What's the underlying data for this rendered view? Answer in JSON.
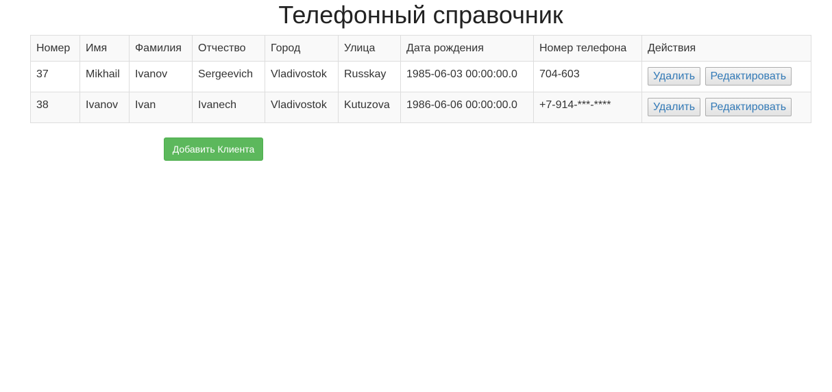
{
  "page": {
    "title": "Телефонный справочник"
  },
  "table": {
    "headers": [
      "Номер",
      "Имя",
      "Фамилия",
      "Отчество",
      "Город",
      "Улица",
      "Дата рождения",
      "Номер телефона",
      "Действия"
    ],
    "rows": [
      {
        "id": "37",
        "first_name": "Mikhail",
        "last_name": "Ivanov",
        "patronymic": "Sergeevich",
        "city": "Vladivostok",
        "street": "Russkay",
        "birth_date": "1985-06-03 00:00:00.0",
        "phone": "704-603",
        "delete_label": "Удалить",
        "edit_label": "Редактировать"
      },
      {
        "id": "38",
        "first_name": "Ivanov",
        "last_name": "Ivan",
        "patronymic": "Ivanech",
        "city": "Vladivostok",
        "street": "Kutuzova",
        "birth_date": "1986-06-06 00:00:00.0",
        "phone": "+7-914-***-****",
        "delete_label": "Удалить",
        "edit_label": "Редактировать"
      }
    ]
  },
  "add_client": {
    "label": "Добавить Клиента"
  },
  "colors": {
    "add_button": "#5cb85c",
    "action_text": "#337ab7"
  }
}
